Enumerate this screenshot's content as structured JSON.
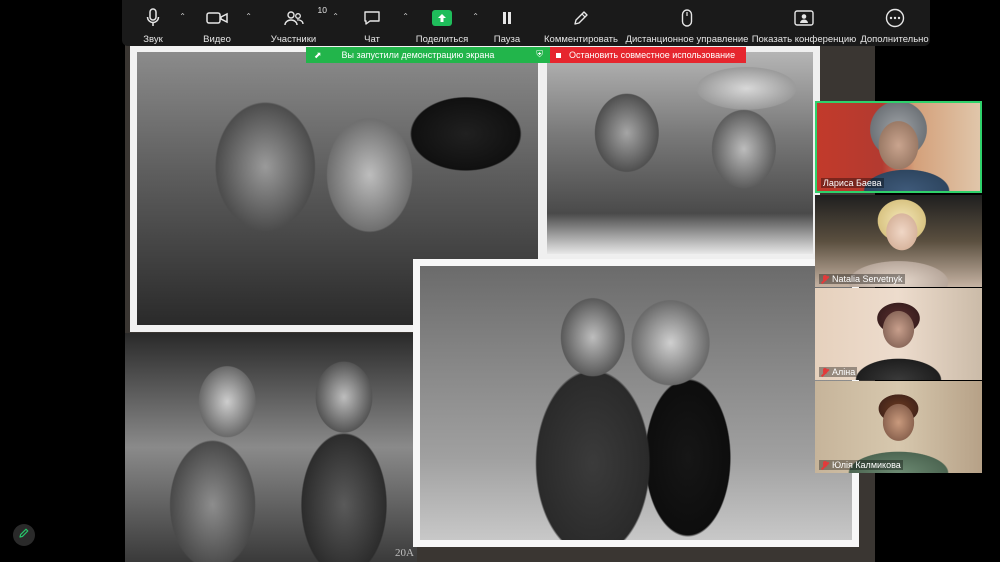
{
  "toolbar": {
    "audio_label": "Звук",
    "video_label": "Видео",
    "participants_label": "Участники",
    "participants_count": "10",
    "chat_label": "Чат",
    "share_label": "Поделиться",
    "pause_label": "Пауза",
    "annotate_label": "Комментировать",
    "remote_control_label": "Дистанционное управление",
    "show_meeting_label": "Показать конференцию",
    "more_label": "Дополнительно",
    "accent_color": "#1fbd5b"
  },
  "share_banner": {
    "status_text": "Вы запустили демонстрацию экрана",
    "stop_text": "Остановить совместное использование",
    "status_color": "#22b54b",
    "stop_color": "#e6262e"
  },
  "slide": {
    "stamp_text": "20A"
  },
  "participants": [
    {
      "name": "Лариса Баева",
      "muted": false,
      "active_speaker": true
    },
    {
      "name": "Natalia Servetnyk",
      "muted": true,
      "active_speaker": false
    },
    {
      "name": "Аліна",
      "muted": true,
      "active_speaker": false
    },
    {
      "name": "Юлія Калмикова",
      "muted": true,
      "active_speaker": false
    }
  ],
  "colors": {
    "active_speaker_border": "#2fd16b",
    "mute_icon": "#e23b3b"
  }
}
